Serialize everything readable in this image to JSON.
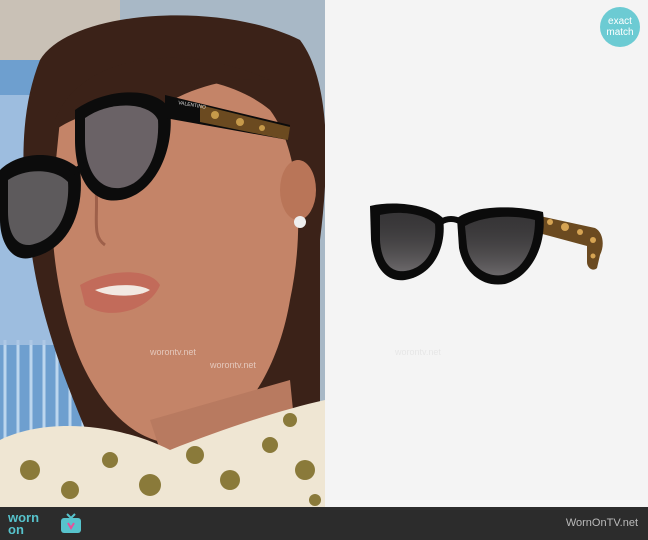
{
  "badge": {
    "line1": "exact",
    "line2": "match"
  },
  "watermark": "worontv.net",
  "footer": {
    "logo_line1": "worn",
    "logo_line2": "on",
    "site": "WornOnTV.net"
  },
  "photo": {
    "frame_brand": "VALENTINO"
  },
  "colors": {
    "accent": "#6ccbd3",
    "footer_bg": "#2c2c2c"
  }
}
